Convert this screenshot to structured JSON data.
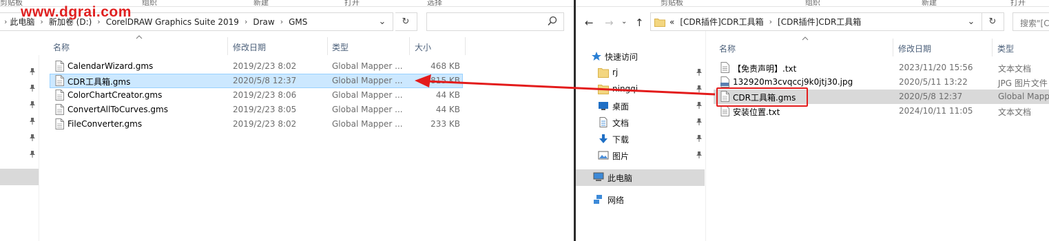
{
  "watermark": "www.dgrai.com",
  "left": {
    "ribbon": [
      "剪贴板",
      "组织",
      "新建",
      "打开",
      "选择"
    ],
    "breadcrumb": [
      "此电脑",
      "新加卷 (D:)",
      "CorelDRAW Graphics Suite 2019",
      "Draw",
      "GMS"
    ],
    "columns": {
      "name": "名称",
      "date": "修改日期",
      "type": "类型",
      "size": "大小"
    },
    "files": [
      {
        "name": "CalendarWizard.gms",
        "date": "2019/2/23 8:02",
        "type": "Global Mapper ...",
        "size": "468 KB"
      },
      {
        "name": "CDR工具箱.gms",
        "date": "2020/5/8 12:37",
        "type": "Global Mapper ...",
        "size": "1,815 KB"
      },
      {
        "name": "ColorChartCreator.gms",
        "date": "2019/2/23 8:06",
        "type": "Global Mapper ...",
        "size": "44 KB"
      },
      {
        "name": "ConvertAllToCurves.gms",
        "date": "2019/2/23 8:05",
        "type": "Global Mapper ...",
        "size": "44 KB"
      },
      {
        "name": "FileConverter.gms",
        "date": "2019/2/23 8:02",
        "type": "Global Mapper ...",
        "size": "233 KB"
      }
    ],
    "selected_index": 1
  },
  "right": {
    "ribbon": [
      "剪贴板",
      "组织",
      "新建",
      "打开"
    ],
    "breadcrumb_prefix": "«",
    "breadcrumb": [
      "[CDR插件]CDR工具箱",
      "[CDR插件]CDR工具箱"
    ],
    "search_placeholder": "搜索\"[C",
    "nav": {
      "quick_access": "快速访问",
      "items": [
        "rj",
        "ningqi",
        "桌面",
        "文档",
        "下载",
        "图片"
      ],
      "this_pc": "此电脑",
      "network": "网络"
    },
    "columns": {
      "name": "名称",
      "date": "修改日期",
      "type": "类型"
    },
    "files": [
      {
        "name": "【免责声明】.txt",
        "date": "2023/11/20 15:56",
        "type": "文本文档",
        "icon": "text-file-icon"
      },
      {
        "name": "132920m3cvqccj9k0jtj30.jpg",
        "date": "2020/5/11 13:22",
        "type": "JPG 图片文件",
        "icon": "jpg-file-icon"
      },
      {
        "name": "CDR工具箱.gms",
        "date": "2020/5/8 12:37",
        "type": "Global Mapp",
        "icon": "gms-file-icon"
      },
      {
        "name": "安装位置.txt",
        "date": "2024/10/11 11:05",
        "type": "文本文档",
        "icon": "text-file-icon"
      }
    ],
    "selected_index": 2
  },
  "colors": {
    "accent_red": "#e31b1b",
    "selection_blue": "#cce8ff",
    "selection_gray": "#d9d9d9",
    "header_text": "#4c607a"
  }
}
